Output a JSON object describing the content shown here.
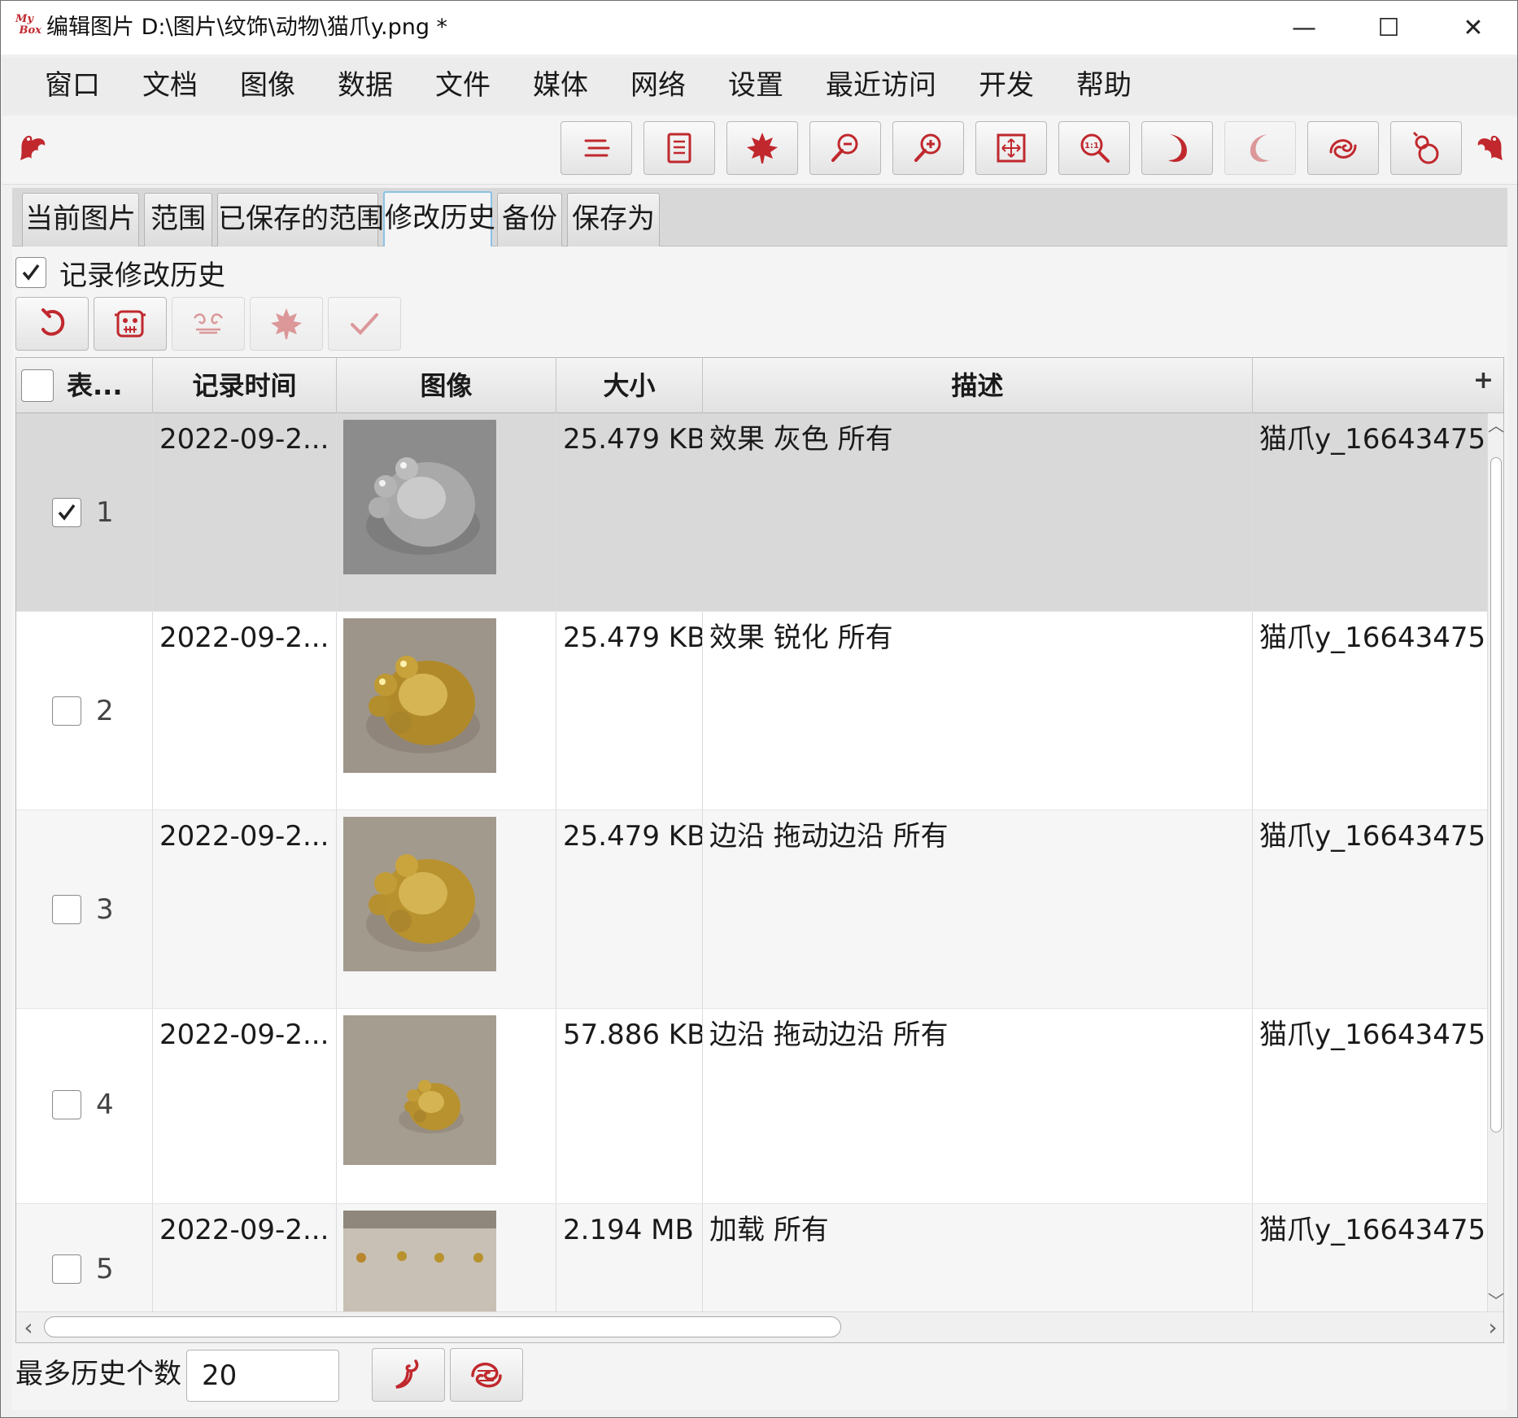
{
  "window": {
    "app_logo": "MyBox",
    "title": "编辑图片 D:\\图片\\纹饰\\动物\\猫爪y.png  *",
    "controls": [
      "—",
      "☐",
      "✕"
    ]
  },
  "menu": [
    "窗口",
    "文档",
    "图像",
    "数据",
    "文件",
    "媒体",
    "网络",
    "设置",
    "最近访问",
    "开发",
    "帮助"
  ],
  "toolbar": {
    "icons": [
      "menu-lines-icon",
      "document-list-icon",
      "maple-leaf-icon",
      "zoom-out-icon",
      "zoom-in-icon",
      "fit-window-icon",
      "actual-size-icon",
      "rotate-right-icon",
      "rotate-left-icon",
      "swirl-icon",
      "gourd-icon"
    ],
    "disabled": [
      false,
      false,
      false,
      false,
      false,
      false,
      false,
      false,
      true,
      false,
      false
    ],
    "accent": "#c0282d"
  },
  "tabs": [
    {
      "label": "当前图片",
      "active": false
    },
    {
      "label": "范围",
      "active": false
    },
    {
      "label": "已保存的范围",
      "active": false
    },
    {
      "label": "修改历史",
      "active": true
    },
    {
      "label": "备份",
      "active": false
    },
    {
      "label": "保存为",
      "active": false
    }
  ],
  "history": {
    "record_label": "记录修改历史",
    "record_checked": true,
    "buttons": [
      {
        "icon": "refresh-icon",
        "disabled": false
      },
      {
        "icon": "mask-icon",
        "disabled": false
      },
      {
        "icon": "pattern-icon",
        "disabled": true
      },
      {
        "icon": "maple-leaf-icon",
        "disabled": true
      },
      {
        "icon": "checkmark-icon",
        "disabled": true
      }
    ]
  },
  "table": {
    "columns": [
      "表...",
      "记录时间",
      "图像",
      "大小",
      "描述",
      ""
    ],
    "rows": [
      {
        "index": "1",
        "checked": true,
        "time": "2022-09-2...",
        "thumb": "gray",
        "size": "25.479 KB",
        "desc": "效果 灰色 所有",
        "file": "猫爪y_16643475"
      },
      {
        "index": "2",
        "checked": false,
        "time": "2022-09-2...",
        "thumb": "gold",
        "size": "25.479 KB",
        "desc": "效果 锐化 所有",
        "file": "猫爪y_16643475"
      },
      {
        "index": "3",
        "checked": false,
        "time": "2022-09-2...",
        "thumb": "gold",
        "size": "25.479 KB",
        "desc": "边沿 拖动边沿 所有",
        "file": "猫爪y_16643475"
      },
      {
        "index": "4",
        "checked": false,
        "time": "2022-09-2...",
        "thumb": "gold-small",
        "size": "57.886 KB",
        "desc": "边沿 拖动边沿 所有",
        "file": "猫爪y_16643475"
      },
      {
        "index": "5",
        "checked": false,
        "time": "2022-09-2...",
        "thumb": "gold-row",
        "size": "2.194 MB",
        "desc": "加载 所有",
        "file": "猫爪y_16643475"
      }
    ]
  },
  "footer": {
    "max_label": "最多历史个数",
    "max_value": "20",
    "buttons": [
      "ok-swirl-icon",
      "cloud-swirl-icon"
    ]
  }
}
